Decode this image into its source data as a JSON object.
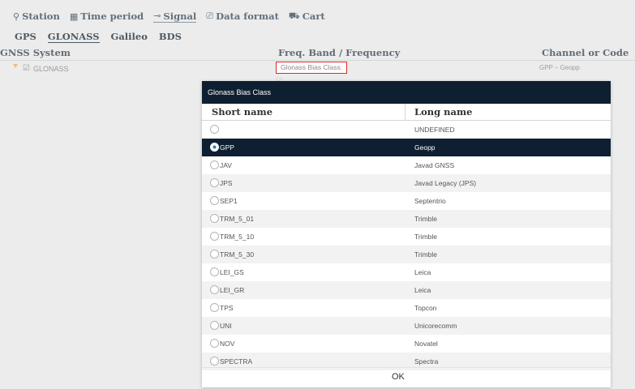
{
  "nav": {
    "items": [
      {
        "icon": "location-pin-icon",
        "glyph": "⚲",
        "label": "Station"
      },
      {
        "icon": "calendar-icon",
        "glyph": "▦",
        "label": "Time period"
      },
      {
        "icon": "signal-icon",
        "glyph": "⊸",
        "label": "Signal",
        "active": true
      },
      {
        "icon": "data-format-icon",
        "glyph": "⎚",
        "label": "Data format"
      },
      {
        "icon": "cart-icon",
        "glyph": "⛟",
        "label": "Cart"
      }
    ]
  },
  "subnav": {
    "items": [
      {
        "label": "GPS"
      },
      {
        "label": "GLONASS",
        "active": true
      },
      {
        "label": "Galileo"
      },
      {
        "label": "BDS"
      }
    ]
  },
  "columns": {
    "gnss": "GNSS System",
    "freq": "Freq. Band / Frequency",
    "channel": "Channel or Code"
  },
  "tree": {
    "system_label": "GLONASS",
    "freq_pill": "Glonass Bias Class:",
    "channel_value": "GPP – Geopp"
  },
  "modal": {
    "title": "Glonass Bias Class",
    "headers": {
      "short": "Short name",
      "long": "Long name"
    },
    "rows": [
      {
        "short": "",
        "long": "UNDEFINED",
        "selected": false
      },
      {
        "short": "GPP",
        "long": "Geopp",
        "selected": true
      },
      {
        "short": "JAV",
        "long": "Javad GNSS",
        "selected": false
      },
      {
        "short": "JPS",
        "long": "Javad Legacy (JPS)",
        "selected": false
      },
      {
        "short": "SEP1",
        "long": "Septentrio",
        "selected": false
      },
      {
        "short": "TRM_5_01",
        "long": "Trimble",
        "selected": false
      },
      {
        "short": "TRM_5_10",
        "long": "Trimble",
        "selected": false
      },
      {
        "short": "TRM_5_30",
        "long": "Trimble",
        "selected": false
      },
      {
        "short": "LEI_GS",
        "long": "Leica",
        "selected": false
      },
      {
        "short": "LEI_GR",
        "long": "Leica",
        "selected": false
      },
      {
        "short": "TPS",
        "long": "Topcon",
        "selected": false
      },
      {
        "short": "UNI",
        "long": "Unicorecomm",
        "selected": false
      },
      {
        "short": "NOV",
        "long": "Novatel",
        "selected": false
      },
      {
        "short": "SPECTRA",
        "long": "Spectra",
        "selected": false
      }
    ],
    "ok_label": "OK"
  },
  "colors": {
    "header_dark": "#0e1f31",
    "highlight_border": "#e02828",
    "tree_arrow": "#e9c26b"
  }
}
